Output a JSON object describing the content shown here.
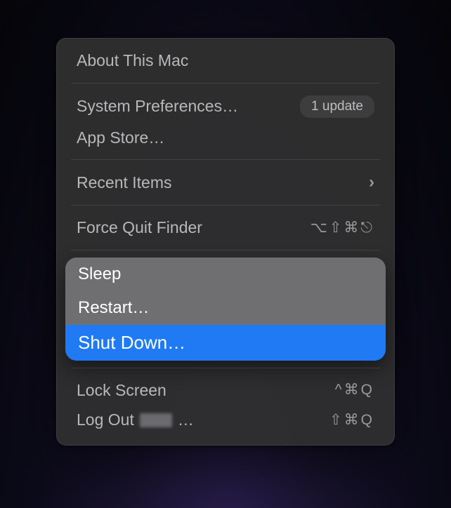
{
  "menu": {
    "about": "About This Mac",
    "sysprefs": "System Preferences…",
    "sysprefs_badge": "1 update",
    "appstore": "App Store…",
    "recent": "Recent Items",
    "force_quit": "Force Quit Finder",
    "force_quit_key": "⌥⇧⌘⎋",
    "sleep": "Sleep",
    "restart": "Restart…",
    "shutdown": "Shut Down…",
    "lock": "Lock Screen",
    "lock_key": "^⌘Q",
    "logout_prefix": "Log Out",
    "logout_suffix": "…",
    "logout_key": "⇧⌘Q"
  }
}
